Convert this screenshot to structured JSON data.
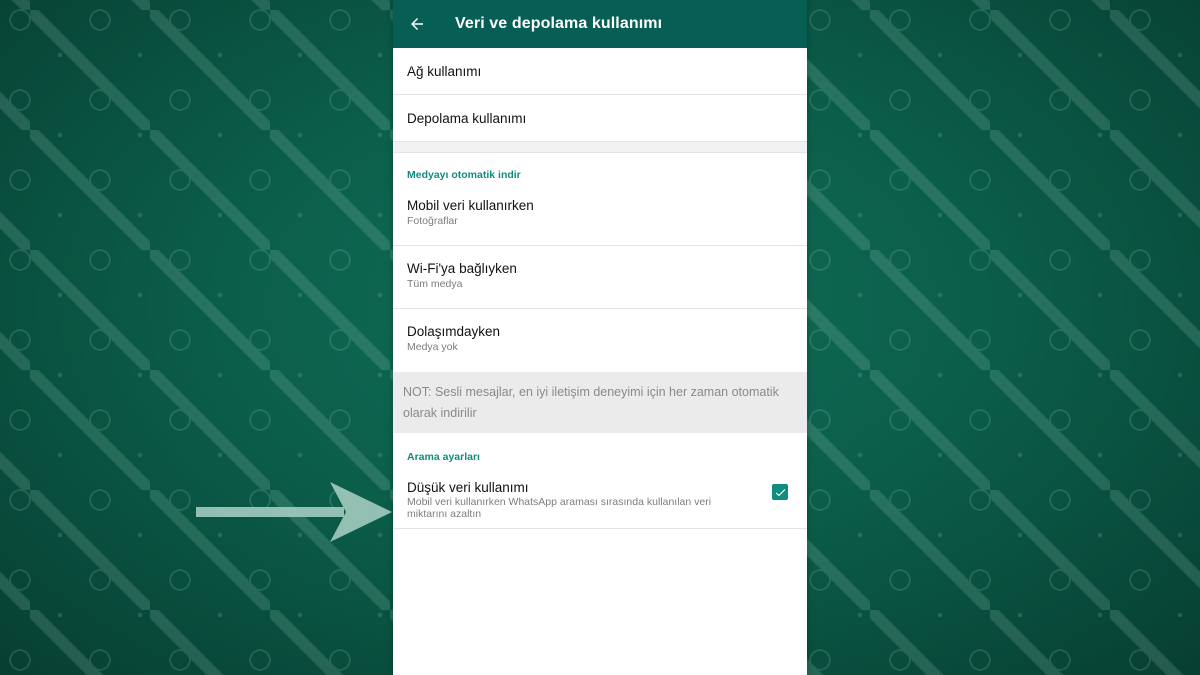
{
  "colors": {
    "appbar": "#075e54",
    "accent": "#128c7e",
    "background": "#0b5e4a"
  },
  "appbar": {
    "back_icon": "arrow-back-icon",
    "title": "Veri ve depolama kullanımı"
  },
  "usage": {
    "network_label": "Ağ kullanımı",
    "storage_label": "Depolama kullanımı"
  },
  "auto_download": {
    "header": "Medyayı otomatik indir",
    "items": [
      {
        "title": "Mobil veri kullanırken",
        "subtitle": "Fotoğraflar"
      },
      {
        "title": "Wi-Fi'ya bağlıyken",
        "subtitle": "Tüm medya"
      },
      {
        "title": "Dolaşımdayken",
        "subtitle": "Medya yok"
      }
    ],
    "note": "NOT: Sesli mesajlar, en iyi iletişim deneyimi için her zaman otomatik olarak indirilir"
  },
  "call_settings": {
    "header": "Arama ayarları",
    "low_data": {
      "title": "Düşük veri kullanımı",
      "subtitle": "Mobil veri kullanırken WhatsApp araması sırasında kullanılan veri miktarını azaltın",
      "checked": true,
      "check_icon": "check-icon"
    }
  },
  "overlay": {
    "arrow_icon": "arrow-right-icon"
  }
}
